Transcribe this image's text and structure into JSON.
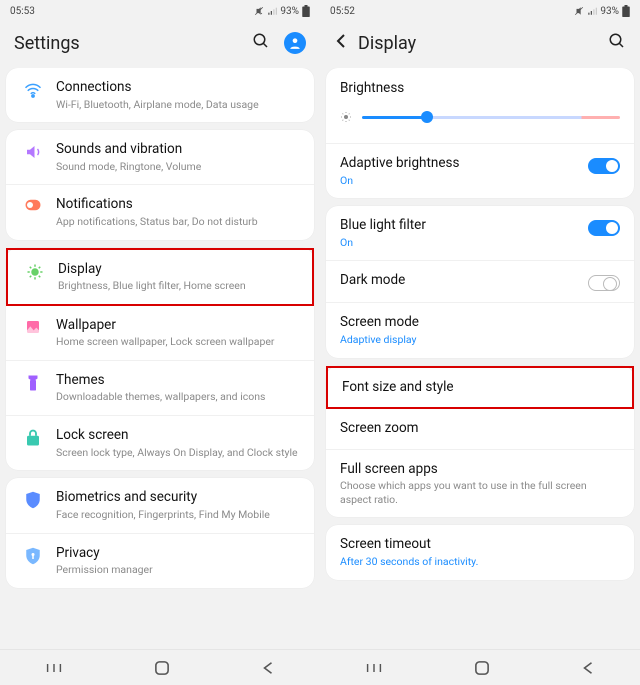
{
  "left": {
    "status": {
      "time": "05:53",
      "battery": "93%"
    },
    "title": "Settings",
    "groups": [
      {
        "items": [
          {
            "label": "Connections",
            "sub": "Wi-Fi, Bluetooth, Airplane mode, Data usage"
          }
        ]
      },
      {
        "items": [
          {
            "label": "Sounds and vibration",
            "sub": "Sound mode, Ringtone, Volume"
          },
          {
            "label": "Notifications",
            "sub": "App notifications, Status bar, Do not disturb"
          }
        ]
      },
      {
        "items": [
          {
            "label": "Display",
            "sub": "Brightness, Blue light filter, Home screen",
            "highlight": true
          },
          {
            "label": "Wallpaper",
            "sub": "Home screen wallpaper, Lock screen wallpaper"
          },
          {
            "label": "Themes",
            "sub": "Downloadable themes, wallpapers, and icons"
          },
          {
            "label": "Lock screen",
            "sub": "Screen lock type, Always On Display, and Clock style"
          }
        ]
      },
      {
        "items": [
          {
            "label": "Biometrics and security",
            "sub": "Face recognition, Fingerprints, Find My Mobile"
          },
          {
            "label": "Privacy",
            "sub": "Permission manager"
          }
        ]
      }
    ]
  },
  "right": {
    "status": {
      "time": "05:52",
      "battery": "93%"
    },
    "title": "Display",
    "brightness_label": "Brightness",
    "groups": [
      {
        "items": [
          {
            "label": "Adaptive brightness",
            "sub_accent": "On",
            "toggle": "on"
          }
        ]
      },
      {
        "items": [
          {
            "label": "Blue light filter",
            "sub_accent": "On",
            "toggle": "on"
          },
          {
            "label": "Dark mode",
            "toggle": "off"
          },
          {
            "label": "Screen mode",
            "sub_accent": "Adaptive display"
          }
        ]
      },
      {
        "items": [
          {
            "label": "Font size and style",
            "highlight": true
          },
          {
            "label": "Screen zoom"
          },
          {
            "label": "Full screen apps",
            "sub": "Choose which apps you want to use in the full screen aspect ratio."
          }
        ]
      },
      {
        "items": [
          {
            "label": "Screen timeout",
            "sub_accent": "After 30 seconds of inactivity."
          }
        ]
      }
    ]
  }
}
